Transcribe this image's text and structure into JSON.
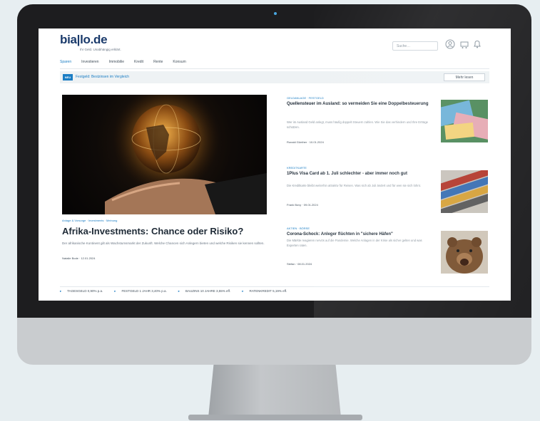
{
  "site": {
    "logo": "bia|lo.de",
    "tagline": "Ihr Geld. Unabhängig erklärt.",
    "search_placeholder": "Suche…",
    "icons": [
      "user-icon",
      "cart-icon",
      "bell-icon"
    ]
  },
  "nav": {
    "items": [
      "Sparen",
      "Investieren",
      "Immobilie",
      "Kredit",
      "Rente",
      "Konsum"
    ]
  },
  "ticker": {
    "badge": "NEU",
    "text": "Festgeld: Bestzinsen im Vergleich",
    "button": "Mehr lesen"
  },
  "hero": {
    "meta": "Anlage & Vorsorge · Investments · Meinung",
    "title": "Afrika-Investments: Chance oder Risiko?",
    "teaser": "Der afrikanische Kontinent gilt als Wachstumsmarkt der Zukunft. Welche Chancen sich Anlegern bieten und welche Risiken sie kennen sollten.",
    "byline": "Natalie Bode · 12.01.2024"
  },
  "articles": [
    {
      "category": "GELDANLAGE · FESTGELD",
      "title": "Quellensteuer im Ausland: so vermeiden Sie eine Doppelbesteuerung",
      "teaser": "Wer im Ausland Geld anlegt, muss häufig doppelt Steuern zahlen. Wie Sie das verhindern und Ihre Erträge schützen.",
      "byline": "Ronald Günther · 10.01.2024"
    },
    {
      "category": "KREDITKARTE",
      "title": "1Plus Visa Card ab 1. Juli schlechter - aber immer noch gut",
      "teaser": "Die Kreditkarte bleibt weiterhin attraktiv für Reisen. Was sich ab Juli ändert und für wen sie sich lohnt.",
      "byline": "Frank Bovy · 09.01.2024"
    },
    {
      "category": "AKTIEN · BÖRSE",
      "title": "Corona-Schock: Anleger flüchten in \"sichere Häfen\"",
      "teaser": "Die Märkte reagieren nervös auf die Pandemie. Welche Anlagen in der Krise als sicher gelten und was Experten raten.",
      "byline": "Stefan · 08.01.2024"
    }
  ],
  "rates": [
    "TAGESGELD 0,90% p.a.",
    "FESTGELD 1 JAHR 3,40% p.a.",
    "BAUZINS 10 JAHRE 3,55% eff.",
    "RATENKREDIT 5,19% eff."
  ],
  "colors": {
    "accent": "#1c7ec4",
    "brand": "#1a3a6b"
  }
}
